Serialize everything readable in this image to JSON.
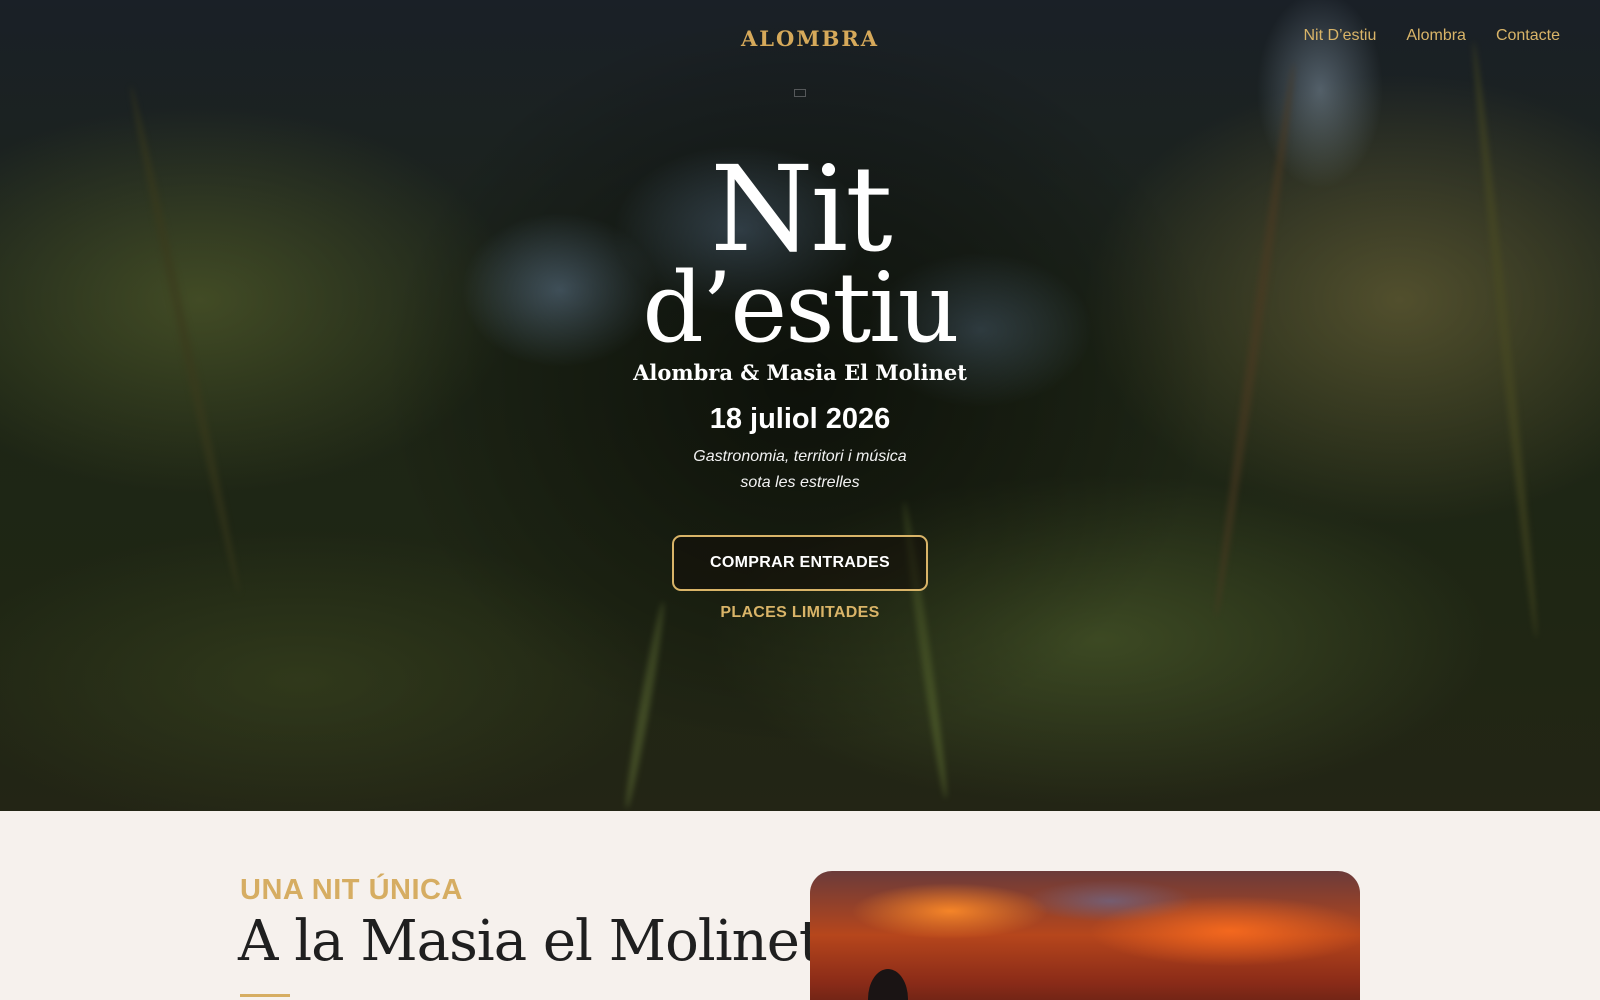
{
  "header": {
    "logo_text": "ALOMBRA",
    "nav": [
      "Nit D’estiu",
      "Alombra",
      "Contacte"
    ]
  },
  "hero": {
    "title_line1": "Nit",
    "title_line2": "d’estiu",
    "subtitle": "Alombra & Masia El Molinet",
    "date": "18 juliol 2026",
    "tagline_line1": "Gastronomia, territori i música",
    "tagline_line2": "sota les estrelles",
    "cta_label": "COMPRAR ENTRADES",
    "note": "PLACES LIMITADES"
  },
  "section": {
    "kicker": "UNA NIT ÚNICA",
    "heading": "A la Masia el Molinet"
  },
  "colors": {
    "accent": "#d6ad62",
    "section_bg": "#f6f1ed",
    "heading_text": "#1f1f1f"
  }
}
